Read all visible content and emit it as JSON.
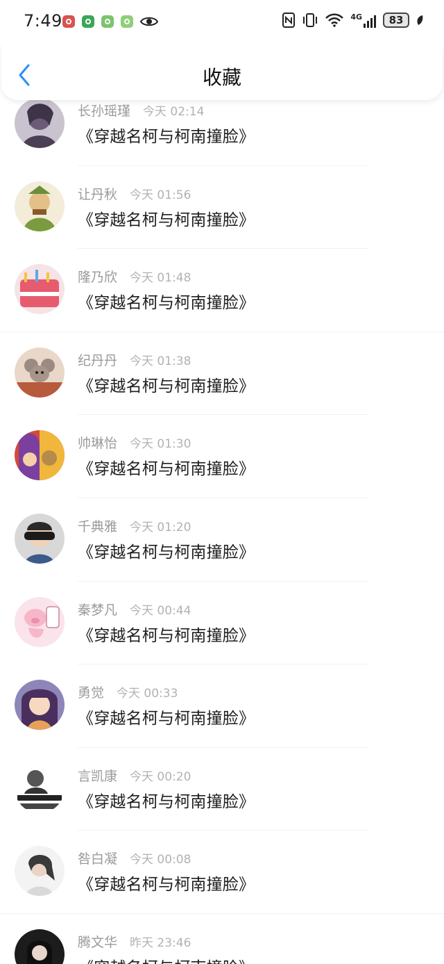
{
  "status_bar": {
    "time": "7:49",
    "network": "4G",
    "battery": "83"
  },
  "header": {
    "title": "收藏",
    "back_icon": "chevron-left-icon"
  },
  "colors": {
    "accent": "#2a8ff7",
    "name_gray": "#9a9a9a",
    "time_gray": "#b2b2b2"
  },
  "items": [
    {
      "user": "长孙瑶瑾",
      "time": "今天 02:14",
      "title": "《穿越名柯与柯南撞脸》"
    },
    {
      "user": "让丹秋",
      "time": "今天 01:56",
      "title": "《穿越名柯与柯南撞脸》"
    },
    {
      "user": "隆乃欣",
      "time": "今天 01:48",
      "title": "《穿越名柯与柯南撞脸》"
    },
    {
      "user": "纪丹丹",
      "time": "今天 01:38",
      "title": "《穿越名柯与柯南撞脸》"
    },
    {
      "user": "帅琳怡",
      "time": "今天 01:30",
      "title": "《穿越名柯与柯南撞脸》"
    },
    {
      "user": "千典雅",
      "time": "今天 01:20",
      "title": "《穿越名柯与柯南撞脸》"
    },
    {
      "user": "秦梦凡",
      "time": "今天 00:44",
      "title": "《穿越名柯与柯南撞脸》"
    },
    {
      "user": "勇觉",
      "time": "今天 00:33",
      "title": "《穿越名柯与柯南撞脸》"
    },
    {
      "user": "言凯康",
      "time": "今天 00:20",
      "title": "《穿越名柯与柯南撞脸》"
    },
    {
      "user": "咎白凝",
      "time": "今天 00:08",
      "title": "《穿越名柯与柯南撞脸》"
    },
    {
      "user": "腾文华",
      "time": "昨天 23:46",
      "title": "《穿越名柯与柯南撞脸》"
    }
  ]
}
